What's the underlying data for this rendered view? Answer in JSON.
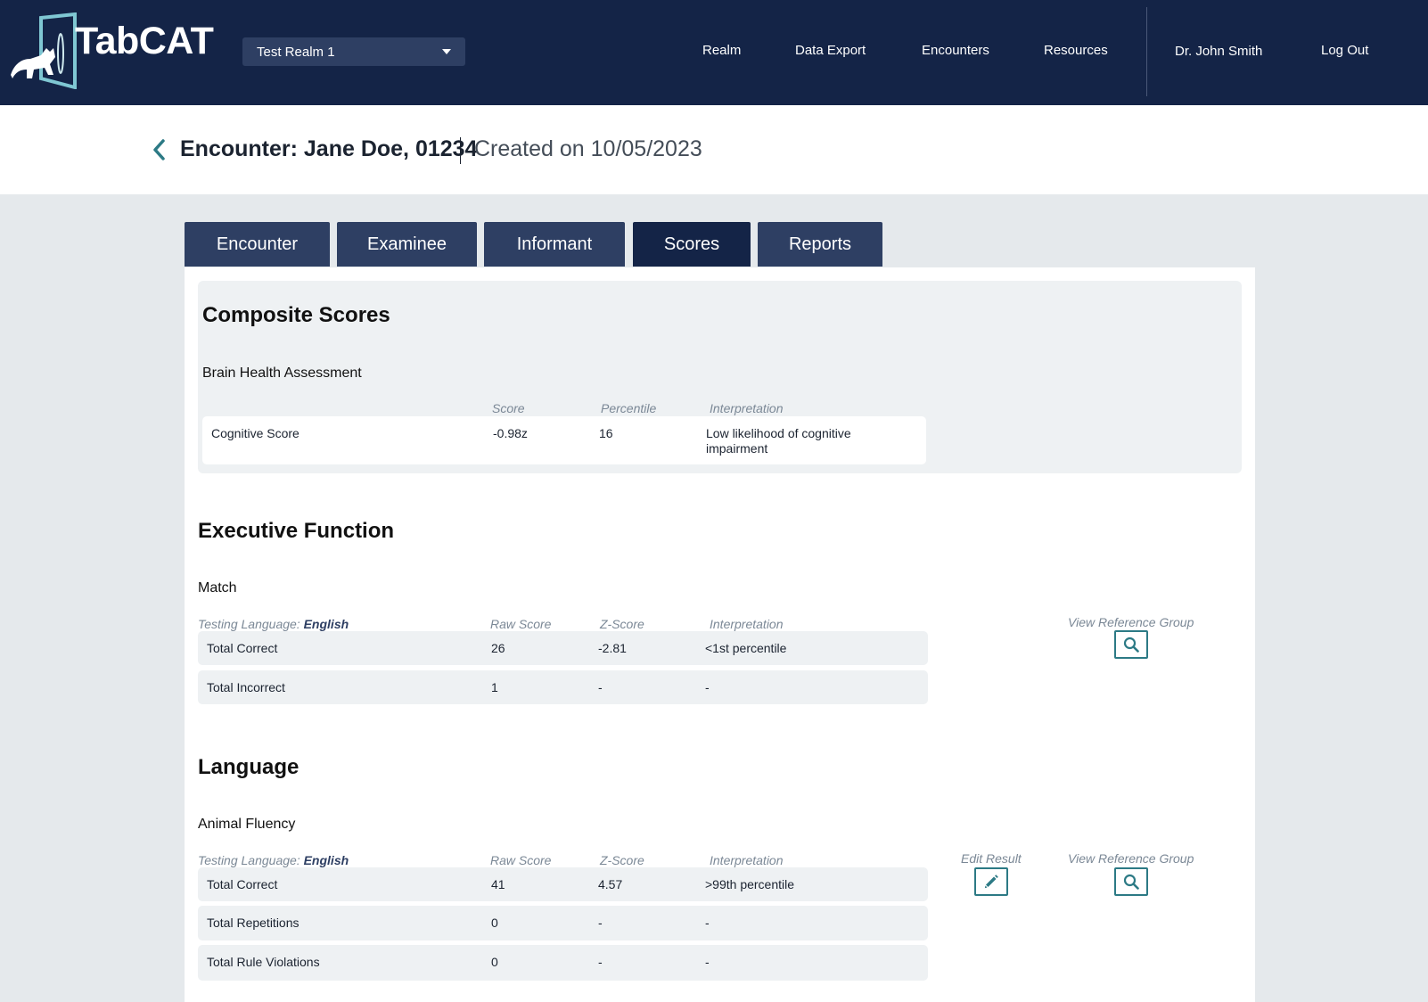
{
  "header": {
    "brand": "TabCAT",
    "realm_selected": "Test Realm 1",
    "nav": [
      "Realm",
      "Data Export",
      "Encounters",
      "Resources"
    ],
    "user_name": "Dr. John Smith",
    "logout_label": "Log Out"
  },
  "encounter": {
    "title": "Encounter: Jane Doe, 01234",
    "created": "Created on 10/05/2023"
  },
  "tabs": [
    {
      "label": "Encounter",
      "active": false
    },
    {
      "label": "Examinee",
      "active": false
    },
    {
      "label": "Informant",
      "active": false
    },
    {
      "label": "Scores",
      "active": true
    },
    {
      "label": "Reports",
      "active": false
    }
  ],
  "composite": {
    "heading": "Composite Scores",
    "assessment": "Brain Health Assessment",
    "columns": [
      "Score",
      "Percentile",
      "Interpretation"
    ],
    "row": {
      "name": "Cognitive Score",
      "score": "-0.98z",
      "percentile": "16",
      "interpretation_line1": "Low likelihood of cognitive",
      "interpretation_line2": "impairment"
    }
  },
  "executive": {
    "heading": "Executive Function",
    "test": "Match",
    "language_label": "Testing Language: ",
    "language_value": "English",
    "columns": [
      "Raw Score",
      "Z-Score",
      "Interpretation"
    ],
    "view_ref_label": "View Reference Group",
    "rows": [
      {
        "name": "Total Correct",
        "raw": "26",
        "z": "-2.81",
        "interp": "<1st percentile"
      },
      {
        "name": "Total Incorrect",
        "raw": "1",
        "z": "-",
        "interp": "-"
      }
    ]
  },
  "language": {
    "heading": "Language",
    "test": "Animal Fluency",
    "language_label": "Testing Language: ",
    "language_value": "English",
    "columns": [
      "Raw Score",
      "Z-Score",
      "Interpretation"
    ],
    "edit_label": "Edit Result",
    "view_ref_label": "View Reference Group",
    "rows": [
      {
        "name": "Total Correct",
        "raw": "41",
        "z": "4.57",
        "interp": ">99th percentile"
      },
      {
        "name": "Total Repetitions",
        "raw": "0",
        "z": "-",
        "interp": "-"
      },
      {
        "name": "Total Rule Violations",
        "raw": "0",
        "z": "-",
        "interp": "-"
      }
    ]
  },
  "colors": {
    "header_bg": "#142447",
    "tab_bg": "#2e3f63",
    "tab_active_bg": "#142447",
    "accent": "#2c7a85",
    "page_bg": "#e5e9ec",
    "row_bg": "#eef1f3"
  },
  "icons": {
    "logo": "cat-portal-icon",
    "back": "chevron-left-icon",
    "dropdown": "caret-down-icon",
    "view_ref": "search-icon",
    "edit": "pencil-icon"
  }
}
